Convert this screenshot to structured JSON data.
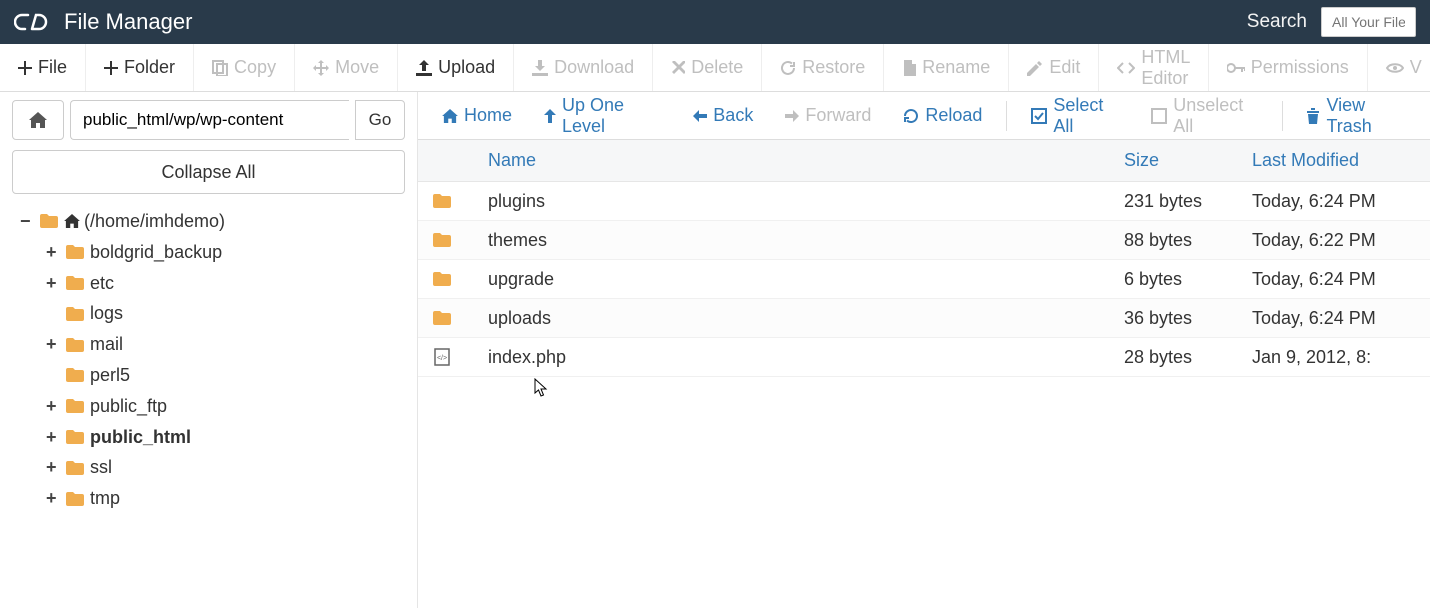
{
  "header": {
    "title": "File Manager",
    "search_label": "Search",
    "search_placeholder": "All Your File"
  },
  "toolbar": [
    {
      "id": "file",
      "label": "File",
      "icon": "plus",
      "enabled": true
    },
    {
      "id": "folder",
      "label": "Folder",
      "icon": "plus",
      "enabled": true
    },
    {
      "id": "copy",
      "label": "Copy",
      "icon": "copy",
      "enabled": false
    },
    {
      "id": "move",
      "label": "Move",
      "icon": "move",
      "enabled": false
    },
    {
      "id": "upload",
      "label": "Upload",
      "icon": "upload",
      "enabled": true
    },
    {
      "id": "download",
      "label": "Download",
      "icon": "download",
      "enabled": false
    },
    {
      "id": "delete",
      "label": "Delete",
      "icon": "delete",
      "enabled": false
    },
    {
      "id": "restore",
      "label": "Restore",
      "icon": "restore",
      "enabled": false
    },
    {
      "id": "rename",
      "label": "Rename",
      "icon": "rename",
      "enabled": false
    },
    {
      "id": "edit",
      "label": "Edit",
      "icon": "edit",
      "enabled": false
    },
    {
      "id": "html-editor",
      "label": "HTML Editor",
      "icon": "html",
      "enabled": false
    },
    {
      "id": "permissions",
      "label": "Permissions",
      "icon": "key",
      "enabled": false
    },
    {
      "id": "view",
      "label": "V",
      "icon": "eye",
      "enabled": false
    }
  ],
  "sidebar": {
    "path_value": "public_html/wp/wp-content",
    "go_label": "Go",
    "collapse_label": "Collapse All",
    "root_label": "(/home/imhdemo)",
    "tree": [
      {
        "label": "boldgrid_backup",
        "expandable": true
      },
      {
        "label": "etc",
        "expandable": true
      },
      {
        "label": "logs",
        "expandable": false
      },
      {
        "label": "mail",
        "expandable": true
      },
      {
        "label": "perl5",
        "expandable": false
      },
      {
        "label": "public_ftp",
        "expandable": true
      },
      {
        "label": "public_html",
        "expandable": true,
        "bold": true
      },
      {
        "label": "ssl",
        "expandable": true
      },
      {
        "label": "tmp",
        "expandable": true
      }
    ]
  },
  "navbar": {
    "home": "Home",
    "up": "Up One Level",
    "back": "Back",
    "forward": "Forward",
    "reload": "Reload",
    "select_all": "Select All",
    "unselect_all": "Unselect All",
    "view_trash": "View Trash"
  },
  "table": {
    "columns": {
      "name": "Name",
      "size": "Size",
      "modified": "Last Modified"
    },
    "rows": [
      {
        "type": "folder",
        "name": "plugins",
        "size": "231 bytes",
        "modified": "Today, 6:24 PM"
      },
      {
        "type": "folder",
        "name": "themes",
        "size": "88 bytes",
        "modified": "Today, 6:22 PM"
      },
      {
        "type": "folder",
        "name": "upgrade",
        "size": "6 bytes",
        "modified": "Today, 6:24 PM"
      },
      {
        "type": "folder",
        "name": "uploads",
        "size": "36 bytes",
        "modified": "Today, 6:24 PM"
      },
      {
        "type": "file",
        "name": "index.php",
        "size": "28 bytes",
        "modified": "Jan 9, 2012, 8:"
      }
    ]
  }
}
